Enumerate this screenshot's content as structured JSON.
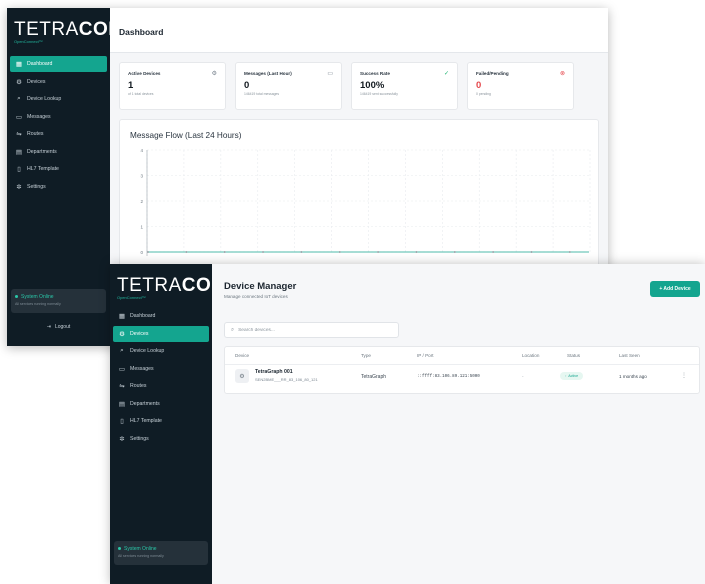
{
  "brand": {
    "name_light": "TETRA",
    "name_bold": "COM",
    "tagline": "OpenConnect™"
  },
  "dashboard": {
    "page_title": "Dashboard",
    "nav": [
      {
        "label": "Dashboard",
        "icon": "grid-icon",
        "active": true
      },
      {
        "label": "Devices",
        "icon": "chip-icon",
        "active": false
      },
      {
        "label": "Device Lookup",
        "icon": "search-icon",
        "active": false
      },
      {
        "label": "Messages",
        "icon": "message-icon",
        "active": false
      },
      {
        "label": "Routes",
        "icon": "routes-icon",
        "active": false
      },
      {
        "label": "Departments",
        "icon": "building-icon",
        "active": false
      },
      {
        "label": "HL7 Template",
        "icon": "file-icon",
        "active": false
      },
      {
        "label": "Settings",
        "icon": "gear-icon",
        "active": false
      }
    ],
    "system_status": {
      "title": "System Online",
      "subtitle": "All services running normally"
    },
    "logout_label": "Logout",
    "stats": [
      {
        "label": "Active Devices",
        "value": "1",
        "sub": "of 1 total devices",
        "icon": "chip-icon",
        "icon_color": "#7a8590",
        "value_color": "#12191f"
      },
      {
        "label": "Messages (Last Hour)",
        "value": "0",
        "sub": "146419 total messages",
        "icon": "message-icon",
        "icon_color": "#7a8590",
        "value_color": "#12191f"
      },
      {
        "label": "Success Rate",
        "value": "100%",
        "sub": "146419 sent successfully",
        "icon": "check-circle-icon",
        "icon_color": "#22b573",
        "value_color": "#12191f"
      },
      {
        "label": "Failed/Pending",
        "value": "0",
        "sub": "0 pending",
        "icon": "x-circle-icon",
        "icon_color": "#e5484d",
        "value_color": "#e5484d"
      }
    ],
    "chart_title": "Message Flow (Last 24 Hours)"
  },
  "chart_data": {
    "type": "line",
    "title": "Message Flow (Last 24 Hours)",
    "xlabel": "",
    "ylabel": "",
    "y_ticks": [
      "4",
      "3",
      "2",
      "1",
      "0"
    ],
    "ylim": [
      0,
      4
    ],
    "series": [
      {
        "values": [
          0,
          0,
          0,
          0,
          0,
          0,
          0,
          0,
          0,
          0,
          0,
          0,
          0,
          0,
          0,
          0,
          0,
          0,
          0,
          0,
          0,
          0,
          0,
          0
        ]
      }
    ],
    "grid": true
  },
  "device_manager": {
    "title": "Device Manager",
    "subtitle": "Manage connected IoT devices",
    "add_button": "+ Add Device",
    "search_placeholder": "Search devices...",
    "nav": [
      {
        "label": "Dashboard",
        "icon": "grid-icon",
        "active": false
      },
      {
        "label": "Devices",
        "icon": "chip-icon",
        "active": true
      },
      {
        "label": "Device Lookup",
        "icon": "search-icon",
        "active": false
      },
      {
        "label": "Messages",
        "icon": "message-icon",
        "active": false
      },
      {
        "label": "Routes",
        "icon": "routes-icon",
        "active": false
      },
      {
        "label": "Departments",
        "icon": "building-icon",
        "active": false
      },
      {
        "label": "HL7 Template",
        "icon": "file-icon",
        "active": false
      },
      {
        "label": "Settings",
        "icon": "gear-icon",
        "active": false
      }
    ],
    "system_status": {
      "title": "System Online",
      "subtitle": "All services running normally"
    },
    "columns": [
      "Device",
      "Type",
      "IP / Port",
      "Location",
      "Status",
      "Last Seen"
    ],
    "rows": [
      {
        "name": "TetraGraph 001",
        "id": "SEN2BME___RR_83_106_80_121",
        "type": "TetraGraph",
        "ip": "::ffff:83.106.89.121:5000",
        "location": "-",
        "status": "Active",
        "last_seen": "1 months ago"
      }
    ]
  },
  "colors": {
    "accent": "#14a58f",
    "sidebar": "#0f1c25",
    "danger": "#e5484d",
    "success": "#22b573"
  }
}
